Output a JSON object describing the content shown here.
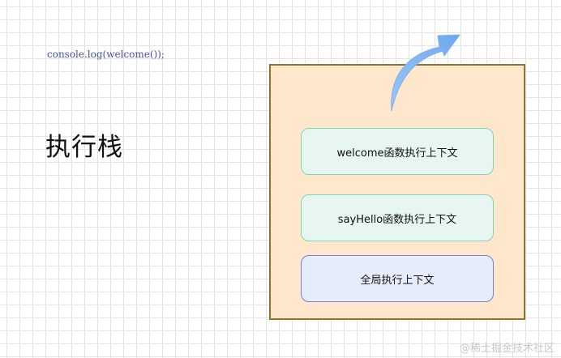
{
  "code_text": "console.log(welcome());",
  "title": "执行栈",
  "frames": {
    "welcome": "welcome函数执行上下文",
    "sayhello": "sayHello函数执行上下文",
    "global": "全局执行上下文"
  },
  "watermark": "@稀土掘金技术社区",
  "colors": {
    "stack_fill": "#ffe7cc",
    "stack_border": "#8f7431",
    "teal_frame_fill": "#e7f6f1",
    "teal_frame_border": "#7fd3b6",
    "blue_frame_fill": "#e7ecfd",
    "blue_frame_border": "#6e86cf",
    "arrow": "#7fb0ee"
  },
  "icons": {
    "arrow": "curved-up-right-arrow-icon"
  }
}
